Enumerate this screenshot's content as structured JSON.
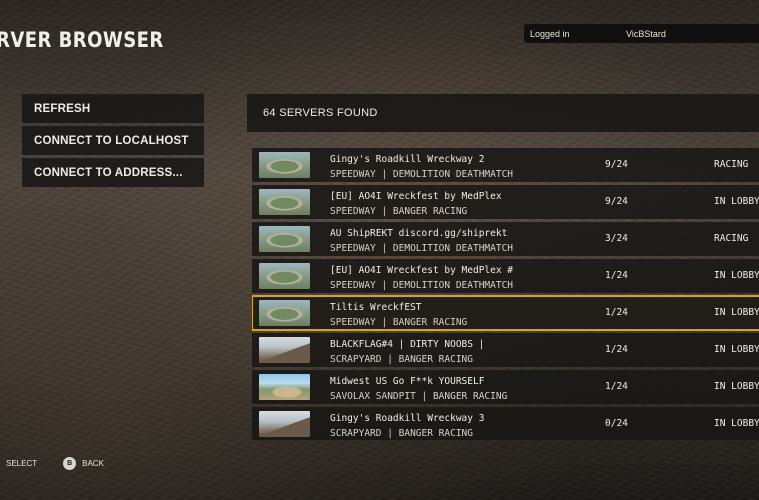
{
  "page_title": "RVER BROWSER",
  "login": {
    "label": "Logged in",
    "username": "VicBStard"
  },
  "menu": [
    {
      "label": "REFRESH"
    },
    {
      "label": "CONNECT TO LOCALHOST"
    },
    {
      "label": "CONNECT TO ADDRESS..."
    }
  ],
  "results": {
    "count_text": "64 SERVERS FOUND"
  },
  "servers": [
    {
      "name": "Gingy's Roadkill Wreckway 2",
      "mode": "SPEEDWAY | DEMOLITION DEATHMATCH",
      "players": "9/24",
      "status": "RACING",
      "thumb": "speedway"
    },
    {
      "name": "[EU] AO4I Wreckfest by MedPlex",
      "mode": "SPEEDWAY | BANGER RACING",
      "players": "9/24",
      "status": "IN LOBBY",
      "thumb": "speedway"
    },
    {
      "name": "AU ShipREKT discord.gg/shiprekt",
      "mode": "SPEEDWAY | DEMOLITION DEATHMATCH",
      "players": "3/24",
      "status": "RACING",
      "thumb": "speedway"
    },
    {
      "name": "[EU] AO4I Wreckfest by MedPlex #",
      "mode": "SPEEDWAY | DEMOLITION DEATHMATCH",
      "players": "1/24",
      "status": "IN LOBBY",
      "thumb": "speedway"
    },
    {
      "name": "Tiltis WreckfEST",
      "mode": "SPEEDWAY | BANGER RACING",
      "players": "1/24",
      "status": "IN LOBBY",
      "thumb": "speedway",
      "selected": true
    },
    {
      "name": "BLACKFLAG#4 | DIRTY NOOBS |",
      "mode": "SCRAPYARD | BANGER RACING",
      "players": "1/24",
      "status": "IN LOBBY",
      "thumb": "scrapyard"
    },
    {
      "name": "Midwest US Go F**k YOURSELF",
      "mode": "SAVOLAX SANDPIT | BANGER RACING",
      "players": "1/24",
      "status": "IN LOBBY",
      "thumb": "sandpit"
    },
    {
      "name": "Gingy's Roadkill Wreckway 3",
      "mode": "SCRAPYARD | BANGER RACING",
      "players": "0/24",
      "status": "IN LOBBY",
      "thumb": "scrapyard"
    }
  ],
  "footer": {
    "select_label": "SELECT",
    "back_button_glyph": "B",
    "back_label": "BACK"
  },
  "colors": {
    "selection_outline": "#d9a31c",
    "panel": "#181614"
  }
}
